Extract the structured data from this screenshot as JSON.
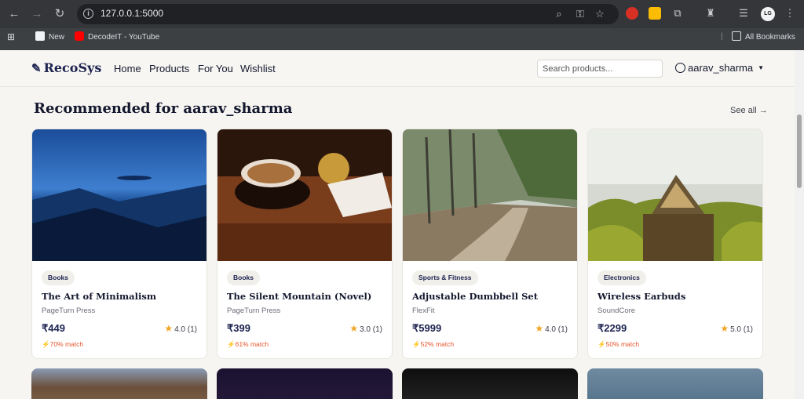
{
  "browser": {
    "url": "127.0.0.1:5000",
    "bookmarks": [
      {
        "label": "New"
      },
      {
        "label": "DecodeIT - YouTube"
      }
    ],
    "all_bookmarks": "All Bookmarks",
    "profile_initials": "LG"
  },
  "header": {
    "brand": "RecoSys",
    "nav": [
      "Home",
      "Products",
      "For You",
      "Wishlist"
    ],
    "search_placeholder": "Search products...",
    "username": "aarav_sharma"
  },
  "section": {
    "title": "Recommended for aarav_sharma",
    "see_all": "See all →"
  },
  "products": [
    {
      "category": "Books",
      "title": "The Art of Minimalism",
      "brand": "PageTurn Press",
      "price": "₹449",
      "rating": "4.0 (1)",
      "match": "70% match"
    },
    {
      "category": "Books",
      "title": "The Silent Mountain (Novel)",
      "brand": "PageTurn Press",
      "price": "₹399",
      "rating": "3.0 (1)",
      "match": "61% match"
    },
    {
      "category": "Sports & Fitness",
      "title": "Adjustable Dumbbell Set",
      "brand": "FlexFit",
      "price": "₹5999",
      "rating": "4.0 (1)",
      "match": "52% match"
    },
    {
      "category": "Electronics",
      "title": "Wireless Earbuds",
      "brand": "SoundCore",
      "price": "₹2299",
      "rating": "5.0 (1)",
      "match": "50% match"
    }
  ],
  "colors": {
    "brand_navy": "#1d2350",
    "match_orange": "#e4572e",
    "star": "#f0a526"
  }
}
